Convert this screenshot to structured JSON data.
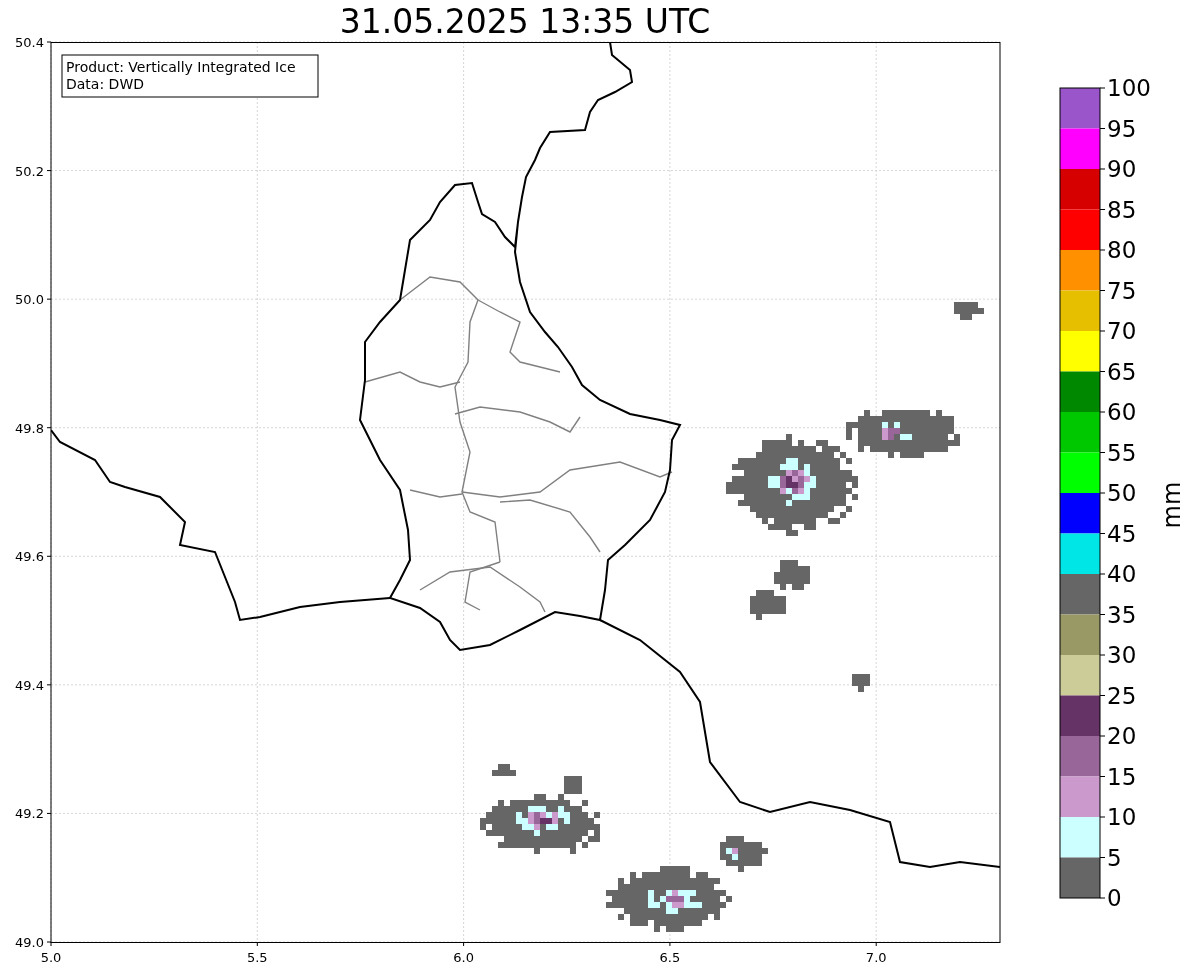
{
  "title": "31.05.2025 13:35 UTC",
  "info_box": [
    "Product: Vertically Integrated Ice",
    "Data: DWD"
  ],
  "map": {
    "x_ticks": [
      "5.0",
      "5.5",
      "6.0",
      "6.5",
      "7.0"
    ],
    "y_ticks": [
      "50.4",
      "50.2",
      "50.0",
      "49.8",
      "49.6",
      "49.4",
      "49.2",
      "49.0"
    ]
  },
  "colorbar": {
    "label": "mm",
    "segments": [
      {
        "color": "#9955c9"
      },
      {
        "color": "#ff00ff"
      },
      {
        "color": "#d60000"
      },
      {
        "color": "#ff0000"
      },
      {
        "color": "#ff9000"
      },
      {
        "color": "#e5bf00"
      },
      {
        "color": "#ffff00"
      },
      {
        "color": "#008800"
      },
      {
        "color": "#00c800"
      },
      {
        "color": "#00ff00"
      },
      {
        "color": "#0000ff"
      },
      {
        "color": "#00e5e5"
      },
      {
        "color": "#666666"
      },
      {
        "color": "#999966"
      },
      {
        "color": "#cccc99"
      },
      {
        "color": "#663366"
      },
      {
        "color": "#996699"
      },
      {
        "color": "#cc99cc"
      },
      {
        "color": "#ccffff"
      },
      {
        "color": "#666666"
      }
    ],
    "ticks": [
      "100",
      "95",
      "90",
      "85",
      "80",
      "75",
      "70",
      "65",
      "60",
      "55",
      "50",
      "45",
      "40",
      "35",
      "30",
      "25",
      "20",
      "15",
      "10",
      "5",
      "0"
    ]
  }
}
